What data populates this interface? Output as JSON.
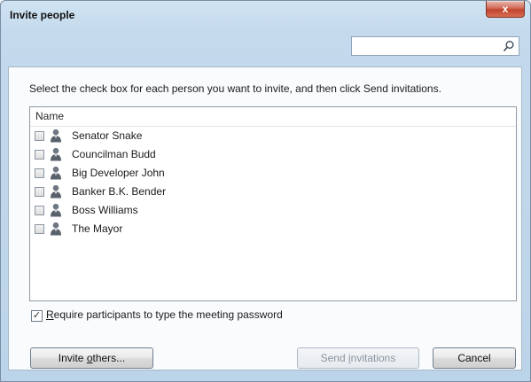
{
  "window": {
    "title": "Invite people",
    "close_label": "x"
  },
  "search": {
    "value": "",
    "placeholder": ""
  },
  "instruction": "Select the check box for each person you want to invite, and then click Send invitations.",
  "list": {
    "header": "Name",
    "items": [
      {
        "label": "Senator Snake",
        "checked": false
      },
      {
        "label": "Councilman Budd",
        "checked": false
      },
      {
        "label": "Big Developer John",
        "checked": false
      },
      {
        "label": "Banker B.K. Bender",
        "checked": false
      },
      {
        "label": "Boss Williams",
        "checked": false
      },
      {
        "label": "The Mayor",
        "checked": false
      }
    ]
  },
  "require_password": {
    "checked": true,
    "label_mnemonic": "R",
    "label_rest": "equire participants to type the meeting password"
  },
  "buttons": {
    "invite_prefix": "Invite ",
    "invite_mnemonic": "o",
    "invite_suffix": "thers...",
    "send_prefix": "Send ",
    "send_mnemonic": "i",
    "send_suffix": "nvitations",
    "cancel": "Cancel"
  },
  "icons": {
    "close": "close-icon",
    "search": "search-icon",
    "person": "person-icon"
  }
}
